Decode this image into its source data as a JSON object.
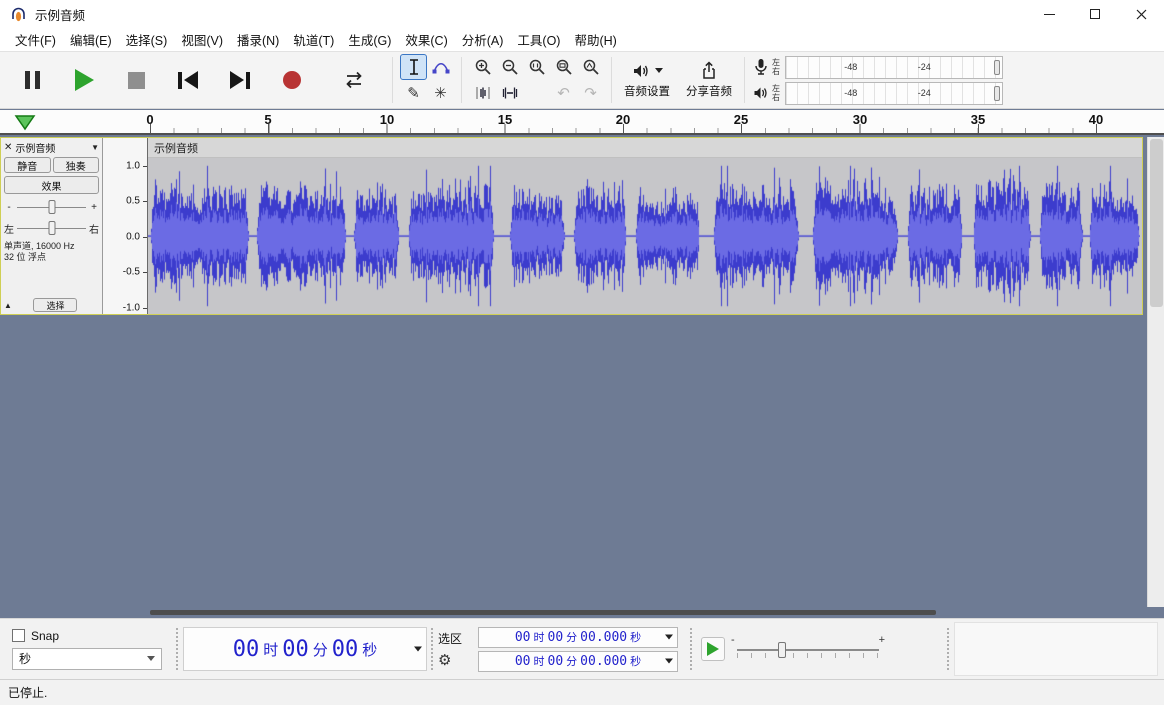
{
  "window": {
    "title": "示例音频"
  },
  "menu": {
    "items": [
      "文件(F)",
      "编辑(E)",
      "选择(S)",
      "视图(V)",
      "播录(N)",
      "轨道(T)",
      "生成(G)",
      "效果(C)",
      "分析(A)",
      "工具(O)",
      "帮助(H)"
    ]
  },
  "toolbar": {
    "audio_setup": "音频设置",
    "share": "分享音频",
    "meter": {
      "left": "左",
      "right": "右",
      "tick1": "-48",
      "tick2": "-24"
    }
  },
  "timeline": {
    "labels": [
      "0",
      "5",
      "10",
      "15",
      "20",
      "25",
      "30",
      "35",
      "40"
    ]
  },
  "track": {
    "name": "示例音频",
    "mute": "静音",
    "solo": "独奏",
    "effects": "效果",
    "gain_minus": "-",
    "gain_plus": "+",
    "pan_left": "左",
    "pan_right": "右",
    "info1": "单声道, 16000 Hz",
    "info2": "32 位 浮点",
    "select": "选择",
    "ruler": [
      "1.0",
      "0.5",
      "0.0",
      "-0.5",
      "-1.0"
    ]
  },
  "waveform": {
    "color_peak": "#3c3ccd",
    "color_rms": "#6b6be4",
    "duration": 41.95,
    "segments": [
      {
        "t0": 0.1,
        "t1": 4.25,
        "amp": 0.82
      },
      {
        "t0": 4.6,
        "t1": 8.35,
        "amp": 0.78
      },
      {
        "t0": 8.7,
        "t1": 10.6,
        "amp": 0.72
      },
      {
        "t0": 11.0,
        "t1": 14.6,
        "amp": 0.86
      },
      {
        "t0": 15.3,
        "t1": 17.6,
        "amp": 0.7
      },
      {
        "t0": 18.0,
        "t1": 20.2,
        "amp": 0.78
      },
      {
        "t0": 20.6,
        "t1": 23.3,
        "amp": 0.72
      },
      {
        "t0": 23.9,
        "t1": 27.5,
        "amp": 0.78
      },
      {
        "t0": 28.1,
        "t1": 31.7,
        "amp": 0.84
      },
      {
        "t0": 32.1,
        "t1": 34.4,
        "amp": 0.78
      },
      {
        "t0": 34.9,
        "t1": 37.3,
        "amp": 0.88
      },
      {
        "t0": 37.7,
        "t1": 39.5,
        "amp": 0.8
      },
      {
        "t0": 39.8,
        "t1": 41.9,
        "amp": 0.84
      }
    ]
  },
  "bottom": {
    "snap": "Snap",
    "snap_unit": "秒",
    "time": {
      "h": "00",
      "hl": "时",
      "m": "00",
      "ml": "分",
      "s": "00",
      "sl": "秒"
    },
    "selection_label": "选区",
    "sel1": {
      "h": "00",
      "hl": "时",
      "m": "00",
      "ml": "分",
      "s": "00.000",
      "sl": "秒"
    },
    "sel2": {
      "h": "00",
      "hl": "时",
      "m": "00",
      "ml": "分",
      "s": "00.000",
      "sl": "秒"
    }
  },
  "status": {
    "text": "已停止."
  },
  "icons": {
    "close": "✕",
    "caret_down": "▼",
    "collapse": "▲",
    "gear": "⚙",
    "pencil": "✎",
    "asterisk": "✳",
    "undo": "↶",
    "redo": "↷"
  }
}
